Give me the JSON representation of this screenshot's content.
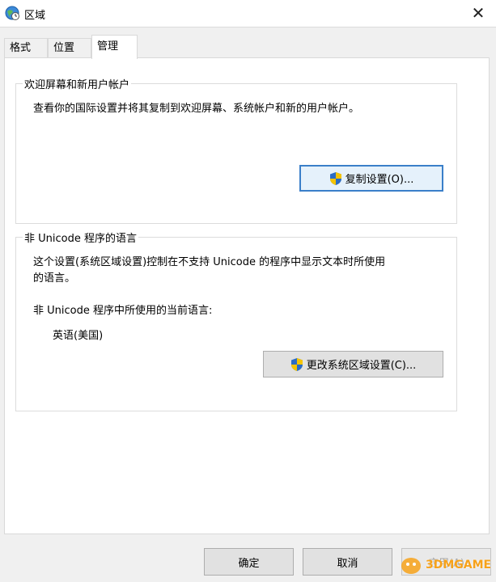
{
  "window": {
    "title": "区域",
    "close_glyph": "✕"
  },
  "tabs": [
    {
      "label": "格式",
      "active": false
    },
    {
      "label": "位置",
      "active": false
    },
    {
      "label": "管理",
      "active": true
    }
  ],
  "welcome_group": {
    "title": "欢迎屏幕和新用户帐户",
    "description": "查看你的国际设置并将其复制到欢迎屏幕、系统帐户和新的用户帐户。",
    "copy_button": "复制设置(O)..."
  },
  "unicode_group": {
    "title": "非 Unicode 程序的语言",
    "description_line1": "这个设置(系统区域设置)控制在不支持 Unicode 的程序中显示文本时所使用",
    "description_line2": "的语言。",
    "current_label": "非 Unicode 程序中所使用的当前语言:",
    "current_value": "英语(美国)",
    "change_button": "更改系统区域设置(C)..."
  },
  "footer": {
    "ok": "确定",
    "cancel": "取消",
    "apply": "应用(A)"
  },
  "watermark": {
    "text": "3DMGAME"
  },
  "colors": {
    "accent": "#3a7fc9",
    "shield_blue": "#2b6cc4",
    "shield_yellow": "#f5c400"
  },
  "icons": {
    "title": "globe-clock-icon",
    "uac": "uac-shield-icon",
    "close": "close-icon"
  }
}
